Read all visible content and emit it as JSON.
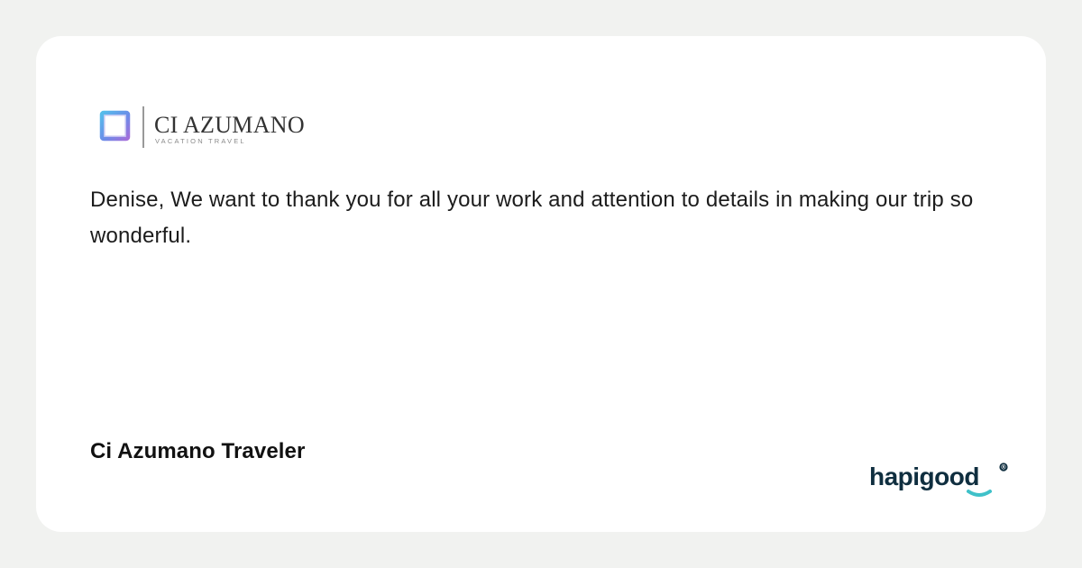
{
  "brand": {
    "name": "CI AZUMANO",
    "tagline": "VACATION TRAVEL",
    "icon": "square-frame-icon"
  },
  "testimonial": {
    "text": "Denise, We want to thank you for all your work and attention to details in making our trip so wonderful.",
    "author": "Ci Azumano Traveler"
  },
  "footer": {
    "logo_text": "hapigood",
    "registered_mark": "®"
  },
  "colors": {
    "page_background": "#f1f2f0",
    "card_background": "#ffffff",
    "text": "#1c1c1c",
    "hapigood_navy": "#0f2e3f",
    "hapigood_accent": "#3fc1c9",
    "brand_icon_blue": "#4a86e8",
    "brand_icon_purple": "#8e63d6"
  }
}
